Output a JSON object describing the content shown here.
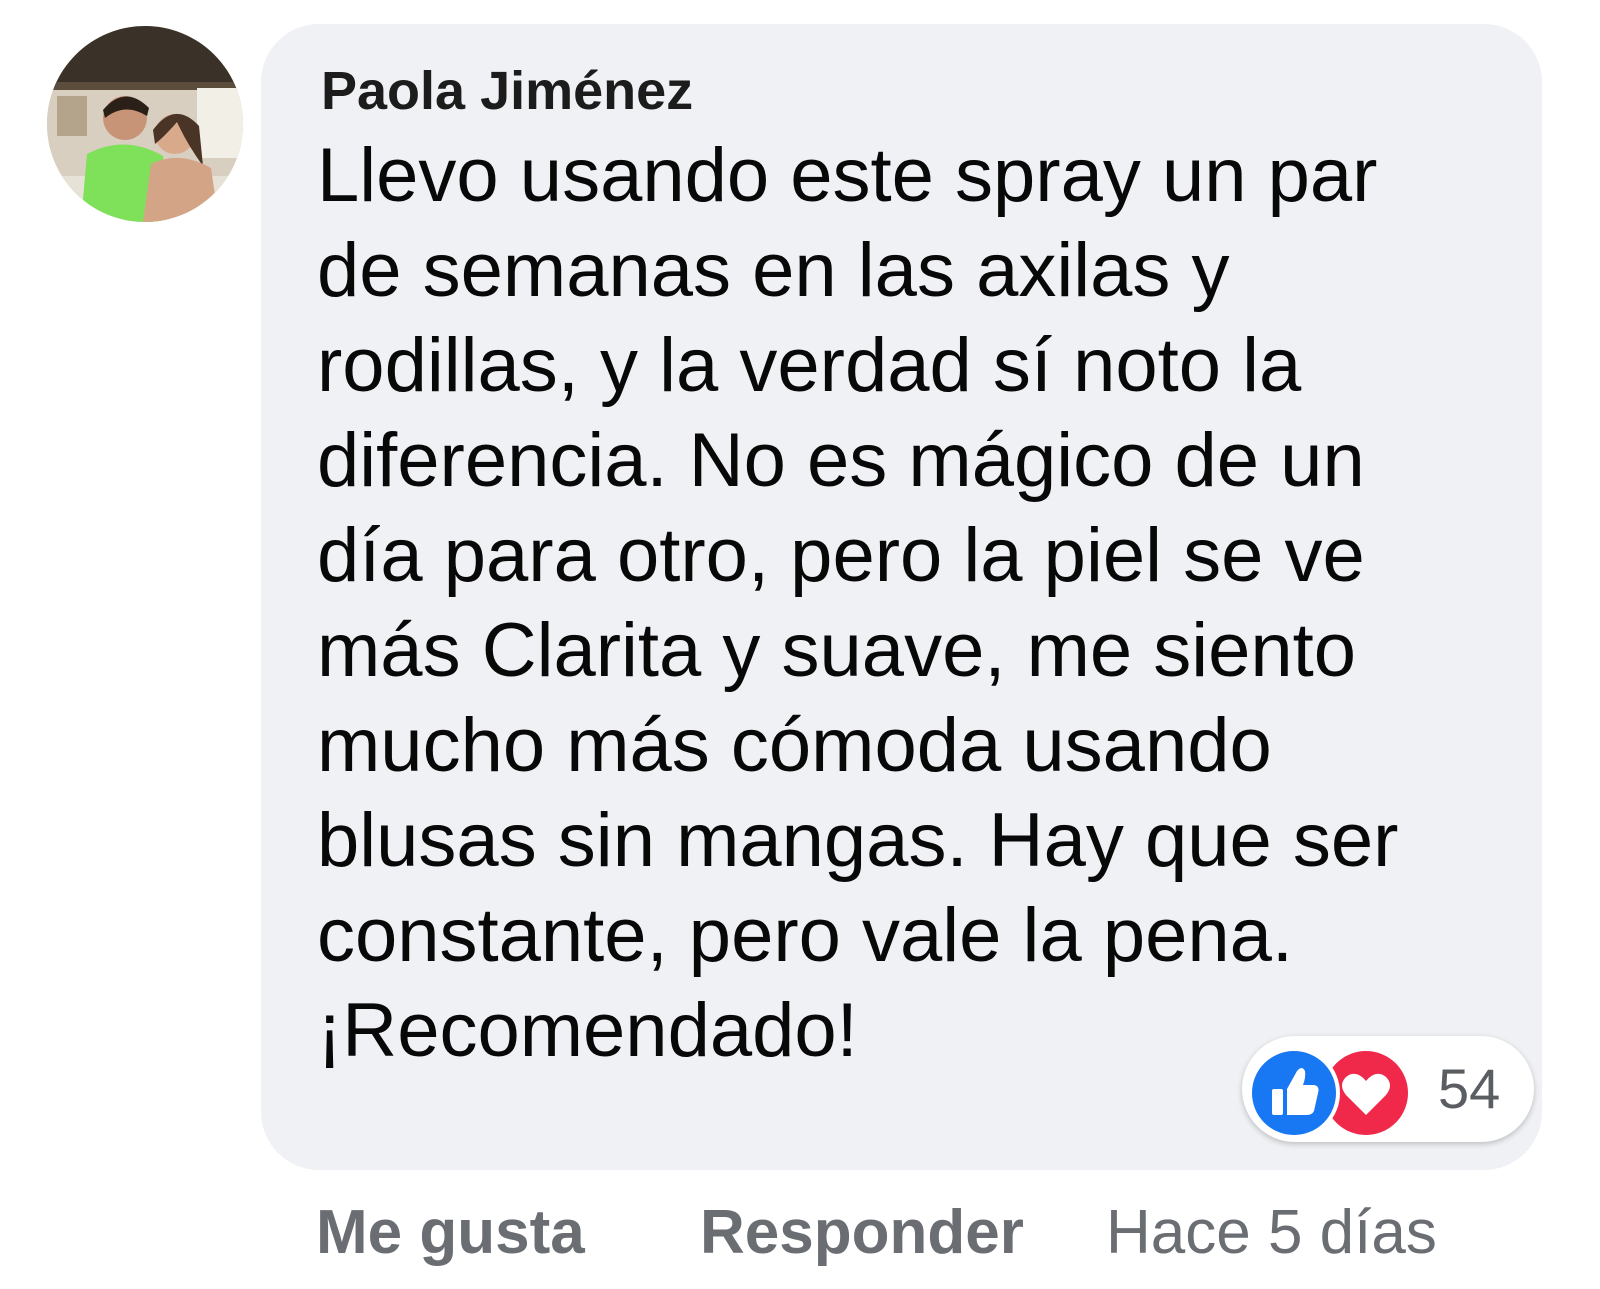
{
  "comment": {
    "author": "Paola Jiménez",
    "text_lines": [
      "Llevo usando este spray un par",
      "de semanas en las axilas y",
      "rodillas, y la verdad sí noto la",
      "diferencia. No es mágico de un",
      "día para otro, pero la piel se ve",
      "más Clarita y suave, me siento",
      "mucho más cómoda usando",
      "blusas sin mangas. Hay que ser",
      "constante, pero vale la pena.",
      "¡Recomendado!"
    ],
    "reactions": {
      "icons": [
        "like-icon",
        "love-icon"
      ],
      "count": "54",
      "colors": {
        "like": "#1877f2",
        "love": "#f02849"
      }
    },
    "actions": {
      "like_label": "Me gusta",
      "reply_label": "Responder",
      "timestamp": "Hace 5 días"
    },
    "colors": {
      "bubble": "#eff1f4",
      "action_text": "#6a6d72"
    }
  }
}
